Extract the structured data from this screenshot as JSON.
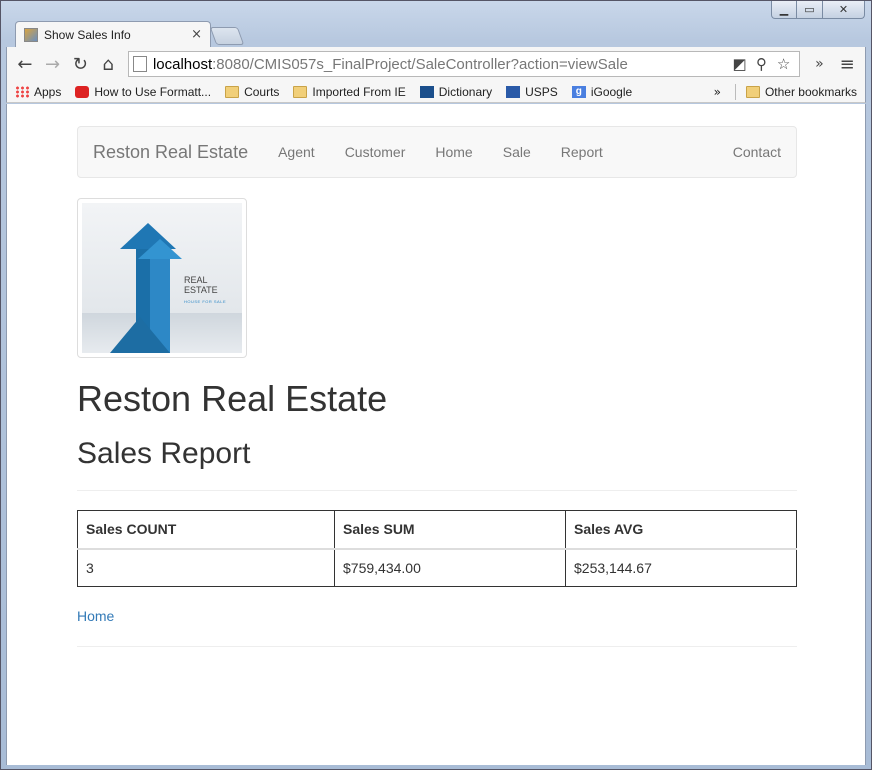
{
  "browser": {
    "tab_title": "Show Sales Info",
    "tab_close": "×",
    "url_host": "localhost",
    "url_rest": ":8080/CMIS057s_FinalProject/SaleController?action=viewSale",
    "bookmarks": [
      {
        "label": "Apps",
        "icon": "apps-icon"
      },
      {
        "label": "How to Use Formatt...",
        "icon": "red-bookmark-icon"
      },
      {
        "label": "Courts",
        "icon": "folder-icon"
      },
      {
        "label": "Imported From IE",
        "icon": "folder-icon"
      },
      {
        "label": "Dictionary",
        "icon": "dictionary-icon"
      },
      {
        "label": "USPS",
        "icon": "usps-icon"
      },
      {
        "label": "iGoogle",
        "icon": "google-icon"
      }
    ],
    "overflow": "»",
    "other_bookmarks": "Other bookmarks"
  },
  "navbar": {
    "brand": "Reston Real Estate",
    "links": [
      "Agent",
      "Customer",
      "Home",
      "Sale",
      "Report"
    ],
    "right_link": "Contact"
  },
  "logo": {
    "line1": "REAL",
    "line2": "ESTATE",
    "sub": "HOUSE FOR SALE"
  },
  "page": {
    "title": "Reston Real Estate",
    "subtitle": "Sales Report",
    "home_link": "Home"
  },
  "report": {
    "headers": [
      "Sales COUNT",
      "Sales SUM",
      "Sales AVG"
    ],
    "rows": [
      [
        "3",
        "$759,434.00",
        "$253,144.67"
      ]
    ]
  },
  "colors": {
    "link": "#337ab7",
    "navbar_bg": "#f8f8f8"
  }
}
